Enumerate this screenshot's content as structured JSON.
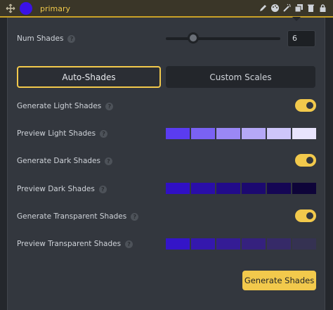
{
  "header": {
    "color_name": "primary",
    "color_hex": "#3b12e6",
    "icons": [
      "pencil-icon",
      "palette-icon",
      "magic-wand-icon",
      "copy-icon",
      "trash-icon",
      "lock-icon"
    ]
  },
  "num_shades": {
    "label": "Num Shades",
    "value": "6",
    "slider_fraction": 0.24
  },
  "tabs": {
    "auto": "Auto-Shades",
    "custom": "Custom Scales",
    "active": "auto"
  },
  "rows": {
    "gen_light": "Generate Light Shades",
    "preview_light": "Preview Light Shades",
    "gen_dark": "Generate Dark Shades",
    "preview_dark": "Preview Dark Shades",
    "gen_transparent": "Generate Transparent Shades",
    "preview_transparent": "Preview Transparent Shades"
  },
  "toggles": {
    "light": true,
    "dark": true,
    "transparent": true
  },
  "light_shades": [
    "#5a3cf0",
    "#7a62f3",
    "#9a88f5",
    "#b5a8f7",
    "#cec6fa",
    "#e8e4fd"
  ],
  "dark_shades": [
    "#3010c4",
    "#2a0ea8",
    "#220b8a",
    "#1c0970",
    "#150654",
    "#0e0439"
  ],
  "transparent_shades": [
    "#3415c8",
    "#3418ad",
    "#341c95",
    "#35217e",
    "#362a68",
    "#353252"
  ],
  "button": {
    "label": "Generate Shades"
  }
}
